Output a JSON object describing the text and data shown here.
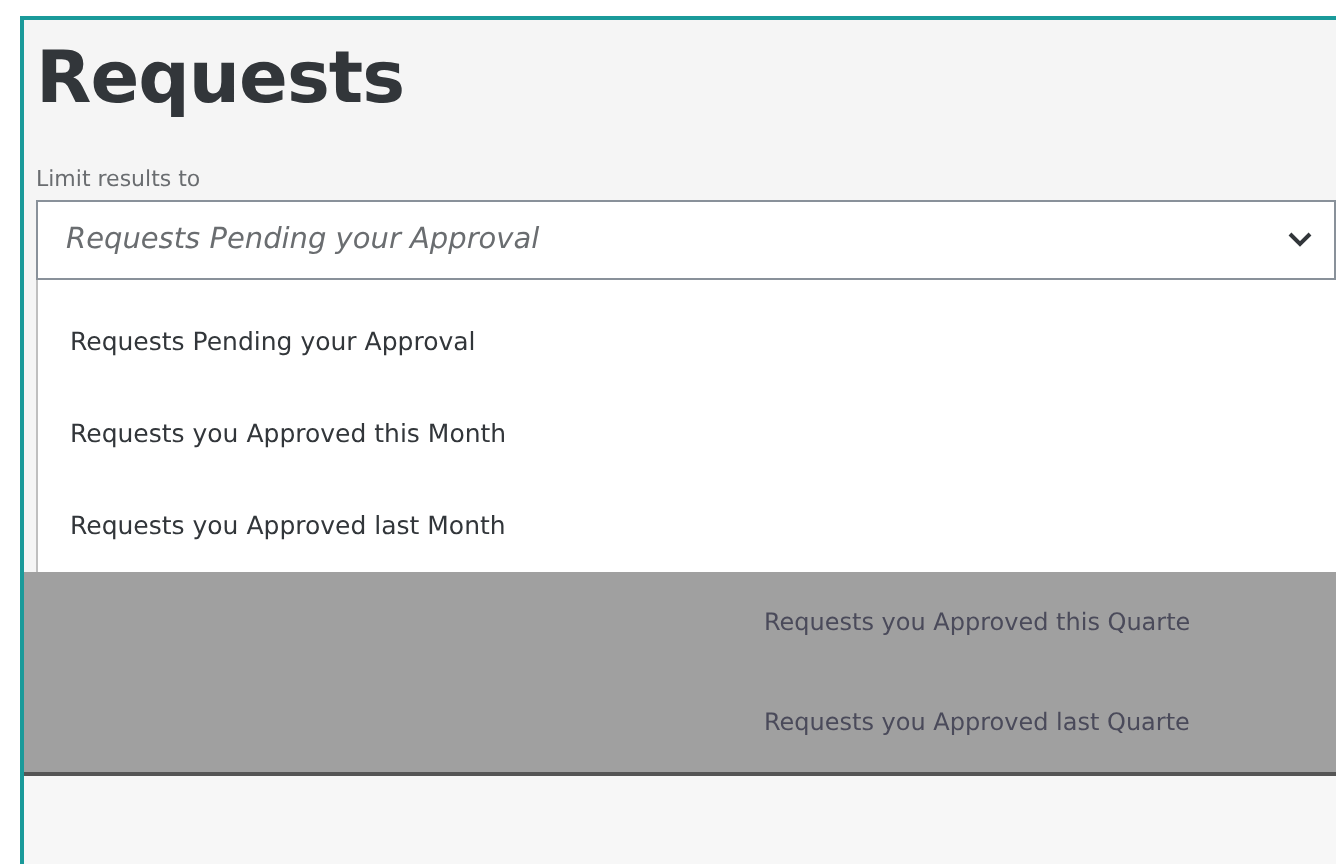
{
  "title": "Requests",
  "filter": {
    "label": "Limit results to",
    "placeholder": "Requests Pending your Approval",
    "expanded": true
  },
  "options": [
    "Requests Pending your Approval",
    "Requests you Approved this Month",
    "Requests you Approved last Month"
  ],
  "garbled_options": [
    "Requests you Approved this Quarte",
    "Requests you Approved last Quarte"
  ]
}
